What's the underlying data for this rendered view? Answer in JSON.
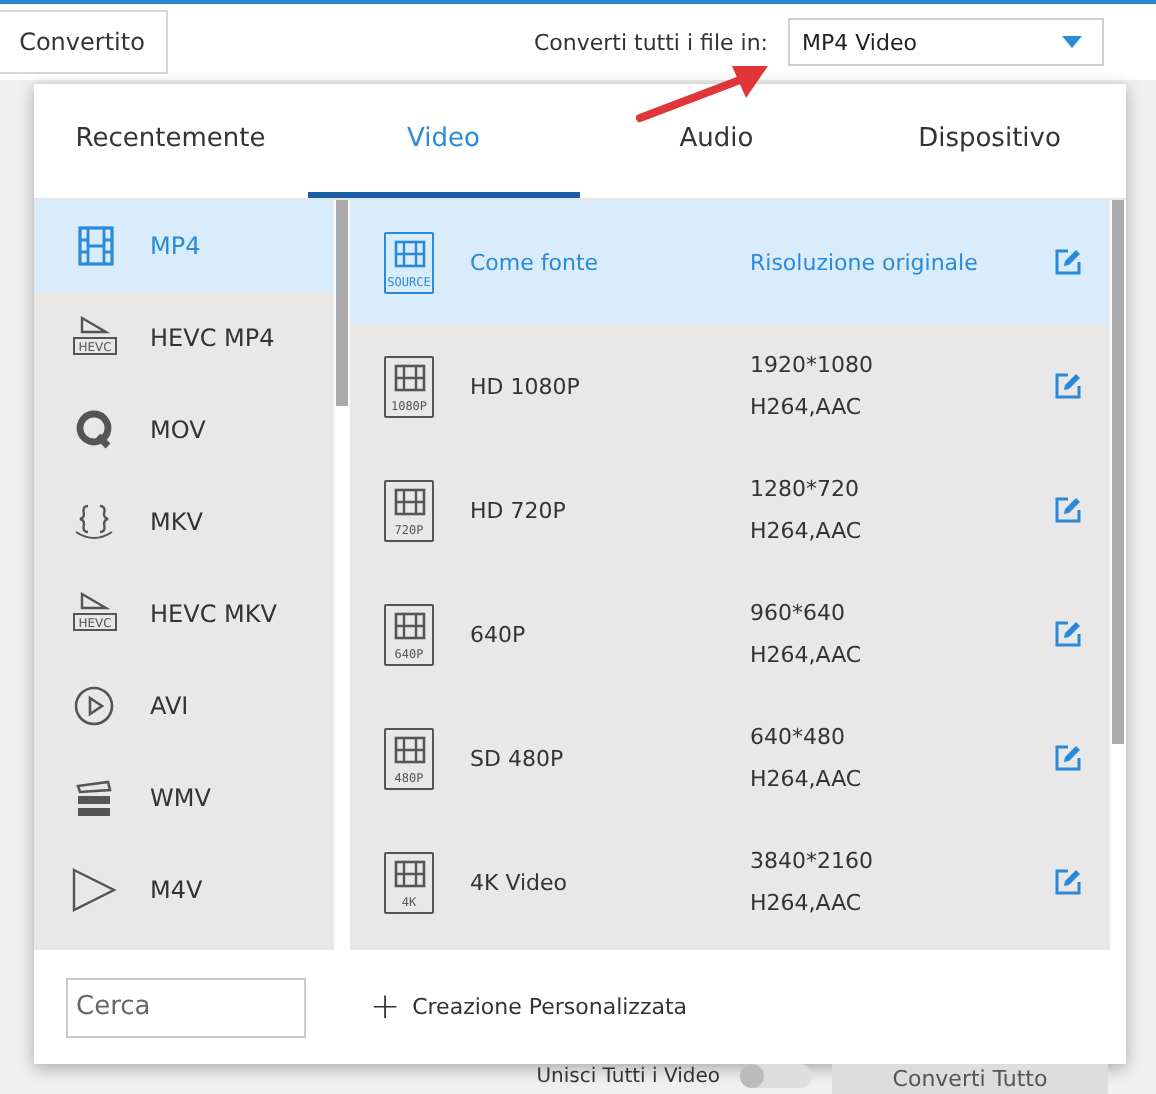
{
  "topbar": {
    "converted_button": "Convertito",
    "convert_all_label": "Converti tutti i file in:",
    "format_dropdown": "MP4 Video"
  },
  "tabs": [
    {
      "label": "Recentemente",
      "selected": false
    },
    {
      "label": "Video",
      "selected": true
    },
    {
      "label": "Audio",
      "selected": false
    },
    {
      "label": "Dispositivo",
      "selected": false
    }
  ],
  "formats": [
    {
      "label": "MP4",
      "kind": "film",
      "selected": true
    },
    {
      "label": "HEVC MP4",
      "kind": "hevc",
      "badge": "HEVC",
      "selected": false
    },
    {
      "label": "MOV",
      "kind": "q",
      "selected": false
    },
    {
      "label": "MKV",
      "kind": "braces",
      "selected": false
    },
    {
      "label": "HEVC MKV",
      "kind": "hevc",
      "badge": "HEVC",
      "selected": false
    },
    {
      "label": "AVI",
      "kind": "play",
      "selected": false
    },
    {
      "label": "WMV",
      "kind": "clapper",
      "selected": false
    },
    {
      "label": "M4V",
      "kind": "triangle",
      "selected": false
    }
  ],
  "presets": [
    {
      "name": "Come fonte",
      "badge": "SOURCE",
      "resolution": "Risoluzione originale",
      "selected": true
    },
    {
      "name": "HD 1080P",
      "badge": "1080P",
      "resolution": "1920*1080",
      "codec": "H264,AAC",
      "selected": false
    },
    {
      "name": "HD 720P",
      "badge": "720P",
      "resolution": "1280*720",
      "codec": "H264,AAC",
      "selected": false
    },
    {
      "name": "640P",
      "badge": "640P",
      "resolution": "960*640",
      "codec": "H264,AAC",
      "selected": false
    },
    {
      "name": "SD 480P",
      "badge": "480P",
      "resolution": "640*480",
      "codec": "H264,AAC",
      "selected": false
    },
    {
      "name": "4K Video",
      "badge": "4K",
      "resolution": "3840*2160",
      "codec": "H264,AAC",
      "selected": false
    }
  ],
  "search": {
    "placeholder": "Cerca"
  },
  "custom_button": {
    "icon": "+",
    "label": "Creazione Personalizzata"
  },
  "bottombar": {
    "merge_label": "Unisci Tutti i Video",
    "merge_on": false,
    "convert_all_button": "Converti Tutto"
  }
}
